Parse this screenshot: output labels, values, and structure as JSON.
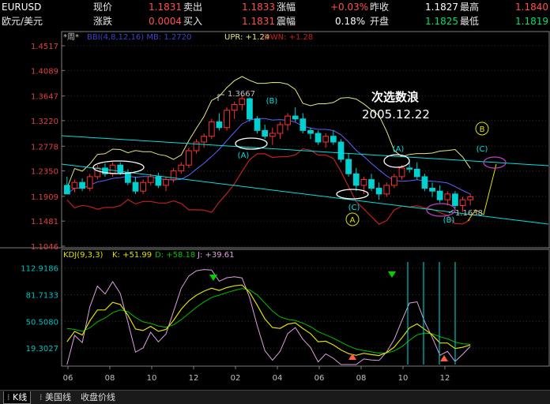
{
  "quote": {
    "symbol": "EURUSD",
    "name": "欧元/美元",
    "r1": [
      {
        "label": "现价",
        "value": "1.1831"
      },
      {
        "label": "卖出",
        "value": "1.1833"
      },
      {
        "label": "涨幅",
        "value": "+0.03%"
      },
      {
        "label": "昨收",
        "value": "1.1827"
      },
      {
        "label": "最高",
        "value": "1.1840"
      }
    ],
    "r2": [
      {
        "label": "涨跌",
        "value": "0.0004"
      },
      {
        "label": "买入",
        "value": "1.1831"
      },
      {
        "label": "震幅",
        "value": "0.18%"
      },
      {
        "label": "开盘",
        "value": "1.1825"
      },
      {
        "label": "最低",
        "value": "1.1819"
      }
    ]
  },
  "main_panel": {
    "period": "*周*",
    "indicator": "BBI(4,8,12,16) MB: 1.2720",
    "upr": "UPR: +1.24",
    "dwn": "DWN: +1.28",
    "y_ticks": [
      "1.4517",
      "1.4089",
      "1.3647",
      "1.3220",
      "1.2778",
      "1.2350",
      "1.1909",
      "1.1481",
      "1.1046"
    ],
    "annotation_title": "次选数浪",
    "annotation_date": "2005.12.22",
    "high_label": "1.3667",
    "low_label": "1.1638",
    "waves": [
      {
        "label": "(A)"
      },
      {
        "label": "(B)"
      },
      {
        "label": "(C)"
      },
      {
        "label": "A"
      },
      {
        "label": "(A)"
      },
      {
        "label": "(B)"
      },
      {
        "label": "B"
      },
      {
        "label": "(C)"
      }
    ]
  },
  "kdj_panel": {
    "indicator": "KDJ(9,3,3)",
    "k": "K: +51.99",
    "d": "D: +58.18",
    "j": "J: +39.61",
    "y_ticks": [
      "112.9186",
      "81.7133",
      "50.5080",
      "19.3027"
    ]
  },
  "x_ticks": [
    "06",
    "08",
    "10",
    "12",
    "02",
    "04",
    "06",
    "08",
    "10",
    "12"
  ],
  "tabs": [
    "K线",
    "美国线",
    "收盘价线"
  ],
  "colors": {
    "up": "#ff3030",
    "down": "#00d0d0",
    "upper": "#e6e680",
    "lower": "#c02020",
    "mid": "#6060ff",
    "trend": "#00e0e0",
    "k": "#e0e000",
    "d": "#00c000",
    "j": "#e0a0e0"
  },
  "chart_data": {
    "type": "candlestick",
    "ylim": [
      1.1046,
      1.4517
    ],
    "kdj_ylim": [
      0,
      120
    ],
    "candles": [
      [
        1.21,
        1.225,
        1.2,
        1.195
      ],
      [
        1.205,
        1.22,
        1.198,
        1.215
      ],
      [
        1.215,
        1.222,
        1.2,
        1.205
      ],
      [
        1.205,
        1.23,
        1.2,
        1.225
      ],
      [
        1.225,
        1.245,
        1.22,
        1.24
      ],
      [
        1.24,
        1.248,
        1.225,
        1.23
      ],
      [
        1.23,
        1.25,
        1.225,
        1.245
      ],
      [
        1.245,
        1.25,
        1.228,
        1.232
      ],
      [
        1.232,
        1.238,
        1.21,
        1.215
      ],
      [
        1.215,
        1.225,
        1.195,
        1.2
      ],
      [
        1.2,
        1.22,
        1.195,
        1.215
      ],
      [
        1.215,
        1.23,
        1.21,
        1.225
      ],
      [
        1.225,
        1.232,
        1.205,
        1.21
      ],
      [
        1.21,
        1.225,
        1.2,
        1.22
      ],
      [
        1.22,
        1.24,
        1.215,
        1.235
      ],
      [
        1.235,
        1.25,
        1.23,
        1.245
      ],
      [
        1.245,
        1.275,
        1.24,
        1.27
      ],
      [
        1.27,
        1.29,
        1.265,
        1.285
      ],
      [
        1.285,
        1.3,
        1.275,
        1.295
      ],
      [
        1.295,
        1.325,
        1.29,
        1.32
      ],
      [
        1.32,
        1.335,
        1.305,
        1.31
      ],
      [
        1.31,
        1.345,
        1.305,
        1.34
      ],
      [
        1.34,
        1.355,
        1.325,
        1.35
      ],
      [
        1.35,
        1.367,
        1.34,
        1.36
      ],
      [
        1.36,
        1.362,
        1.32,
        1.325
      ],
      [
        1.325,
        1.33,
        1.3,
        1.305
      ],
      [
        1.305,
        1.315,
        1.29,
        1.295
      ],
      [
        1.295,
        1.31,
        1.28,
        1.3
      ],
      [
        1.3,
        1.32,
        1.29,
        1.315
      ],
      [
        1.315,
        1.335,
        1.305,
        1.33
      ],
      [
        1.33,
        1.345,
        1.32,
        1.325
      ],
      [
        1.325,
        1.335,
        1.3,
        1.305
      ],
      [
        1.305,
        1.31,
        1.29,
        1.3
      ],
      [
        1.3,
        1.305,
        1.28,
        1.285
      ],
      [
        1.285,
        1.3,
        1.275,
        1.295
      ],
      [
        1.295,
        1.305,
        1.28,
        1.285
      ],
      [
        1.285,
        1.29,
        1.25,
        1.255
      ],
      [
        1.255,
        1.265,
        1.225,
        1.23
      ],
      [
        1.23,
        1.24,
        1.2,
        1.21
      ],
      [
        1.21,
        1.225,
        1.195,
        1.22
      ],
      [
        1.22,
        1.23,
        1.2,
        1.205
      ],
      [
        1.205,
        1.215,
        1.185,
        1.195
      ],
      [
        1.195,
        1.215,
        1.19,
        1.21
      ],
      [
        1.21,
        1.23,
        1.205,
        1.225
      ],
      [
        1.225,
        1.245,
        1.22,
        1.24
      ],
      [
        1.24,
        1.255,
        1.232,
        1.238
      ],
      [
        1.238,
        1.25,
        1.22,
        1.225
      ],
      [
        1.225,
        1.23,
        1.2,
        1.205
      ],
      [
        1.205,
        1.215,
        1.19,
        1.2
      ],
      [
        1.2,
        1.21,
        1.18,
        1.185
      ],
      [
        1.185,
        1.2,
        1.175,
        1.195
      ],
      [
        1.195,
        1.2,
        1.17,
        1.175
      ],
      [
        1.175,
        1.19,
        1.164,
        1.185
      ],
      [
        1.185,
        1.195,
        1.175,
        1.19
      ]
    ]
  }
}
